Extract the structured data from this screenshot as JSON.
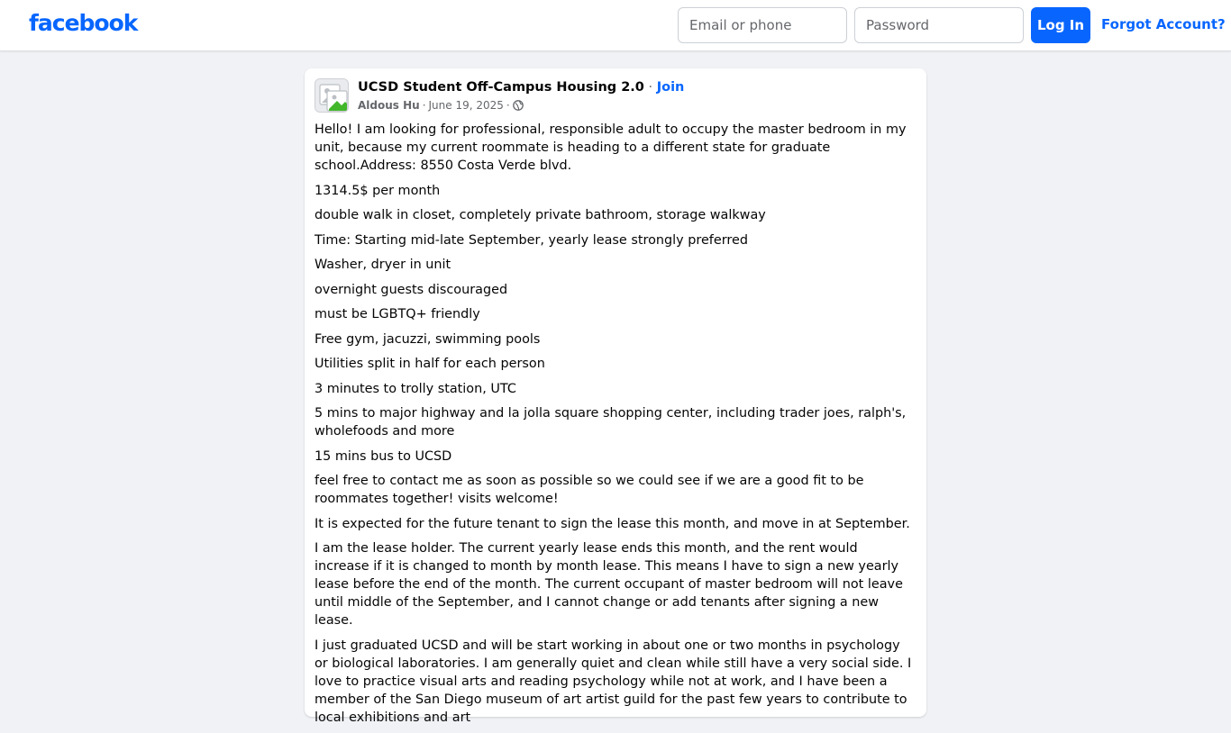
{
  "header": {
    "logo": "facebook",
    "email_placeholder": "Email or phone",
    "password_placeholder": "Password",
    "login_label": "Log In",
    "forgot_label": "Forgot Account?"
  },
  "post": {
    "group_name": "UCSD Student Off-Campus Housing 2.0",
    "separator": " · ",
    "join_label": "Join",
    "author": "Aldous Hu",
    "date": "June 19, 2025",
    "privacy_icon": "globe-icon",
    "paragraphs": [
      "Hello! I am looking for professional, responsible adult to occupy the master bedroom in my unit, because my current roommate is heading to a different state for graduate school.Address: 8550 Costa Verde blvd.",
      "1314.5$ per month",
      "double walk in closet, completely private bathroom, storage walkway",
      "Time: Starting mid-late September, yearly lease strongly preferred",
      "Washer, dryer in unit",
      "overnight guests discouraged",
      "must be LGBTQ+ friendly",
      "Free gym, jacuzzi, swimming pools",
      "Utilities split in half for each person",
      "3 minutes to trolly station, UTC",
      "5 mins to major highway and la jolla square shopping center, including trader joes, ralph's, wholefoods and more",
      "15 mins bus to UCSD",
      "feel free to contact me as soon as possible so we could see if we are a good fit to be roommates together! visits welcome!",
      "It is expected for the future tenant to sign the lease this month, and move in at September.",
      "I am the lease holder. The current yearly lease ends this month, and the rent would increase if it is changed to month by month lease. This means I have to sign a new yearly lease before the end of the month. The current occupant of master bedroom will not leave until middle of the September, and I cannot change or add tenants after signing a new lease.",
      "I just graduated UCSD and will be start working in about one or two months in psychology or biological laboratories. I am generally quiet and clean while still have a very social side. I love to practice visual arts and reading psychology while not at work, and I have been a member of the San Diego museum of art artist guild for the past few years to contribute to local exhibitions and art"
    ]
  },
  "colors": {
    "brand": "#0866ff",
    "background": "#f0f2f5",
    "secondary_text": "#65676b"
  }
}
